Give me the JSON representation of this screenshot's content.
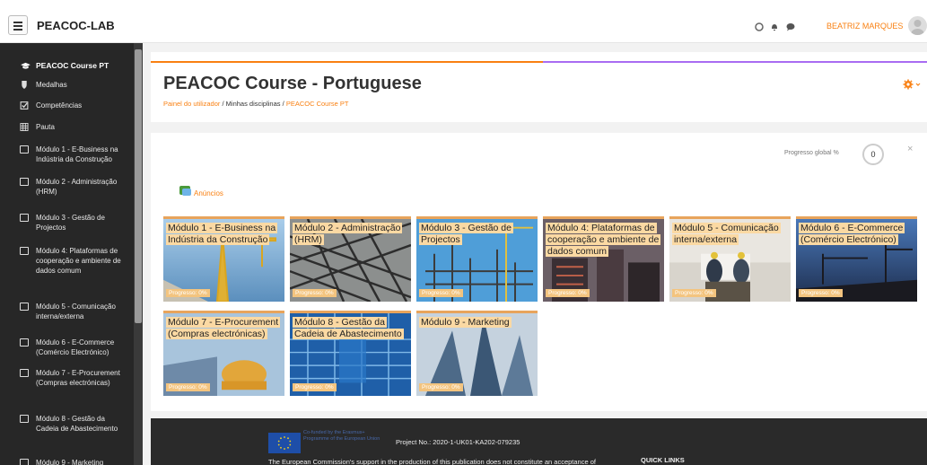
{
  "navbar": {
    "brand": "PEACOC-LAB",
    "user_name": "BEATRIZ MARQUES"
  },
  "sidebar": {
    "items": [
      {
        "label": "PEACOC Course PT",
        "icon": "graduation-cap-icon"
      },
      {
        "label": "Medalhas",
        "icon": "shield-icon"
      },
      {
        "label": "Competências",
        "icon": "checkbox-icon"
      },
      {
        "label": "Pauta",
        "icon": "table-icon"
      },
      {
        "label": "Módulo 1 - E-Business na Indústria da Construção",
        "icon": "folder-icon"
      },
      {
        "label": "Módulo 2 - Administração (HRM)",
        "icon": "folder-icon"
      },
      {
        "label": "Módulo 3 - Gestão de Projectos",
        "icon": "folder-icon"
      },
      {
        "label": "Módulo 4: Plataformas de cooperação e ambiente de dados comum",
        "icon": "folder-icon"
      },
      {
        "label": "Módulo 5 - Comunicação interna/externa",
        "icon": "folder-icon"
      },
      {
        "label": "Módulo 6 - E-Commerce (Comércio Electrónico)",
        "icon": "folder-icon"
      },
      {
        "label": "Módulo 7 - E-Procurement (Compras electrónicas)",
        "icon": "folder-icon"
      },
      {
        "label": "Módulo 8 - Gestão da Cadeia de Abastecimento",
        "icon": "folder-icon"
      },
      {
        "label": "Módulo 9 - Marketing",
        "icon": "folder-icon"
      }
    ]
  },
  "page": {
    "title": "PEACOC Course - Portuguese",
    "breadcrumb": [
      "Painel do utilizador",
      "Minhas disciplinas",
      "PEACOC Course PT"
    ],
    "breadcrumb_sep": "/"
  },
  "content": {
    "progress_label": "Progresso global %",
    "progress_value": "0",
    "close_symbol": "×",
    "announcements": "Anúncios",
    "progress_tile_label": "Progresso: 0%",
    "modules": [
      {
        "name": "Módulo 1 - E-Business na Indústria da Construção"
      },
      {
        "name": "Módulo 2 - Administração (HRM)"
      },
      {
        "name": "Módulo 3 - Gestão de Projectos"
      },
      {
        "name": "Módulo 4: Plataformas de cooperação e ambiente de dados comum"
      },
      {
        "name": "Módulo 5 - Comunicação interna/externa"
      },
      {
        "name": "Módulo 6 - E-Commerce (Comércio Electrónico)"
      },
      {
        "name": "Módulo 7 - E-Procurement (Compras electrónicas)"
      },
      {
        "name": "Módulo 8 - Gestão da Cadeia de Abastecimento"
      },
      {
        "name": "Módulo 9 - Marketing"
      }
    ]
  },
  "footer": {
    "eu_text": "Co-funded by the Erasmus+ Programme of the European Union",
    "project": "Project No.: 2020-1-UK01-KA202-079235",
    "disclaimer": "The European Commission's support in the production of this publication does not constitute an acceptance of",
    "quick_links": "QUICK LINKS"
  },
  "colors": {
    "accent": "#f98012",
    "sidebar_bg": "#272727",
    "tile_label_bg": "#fbd9a3",
    "footer_bg": "#2a2a2a"
  }
}
